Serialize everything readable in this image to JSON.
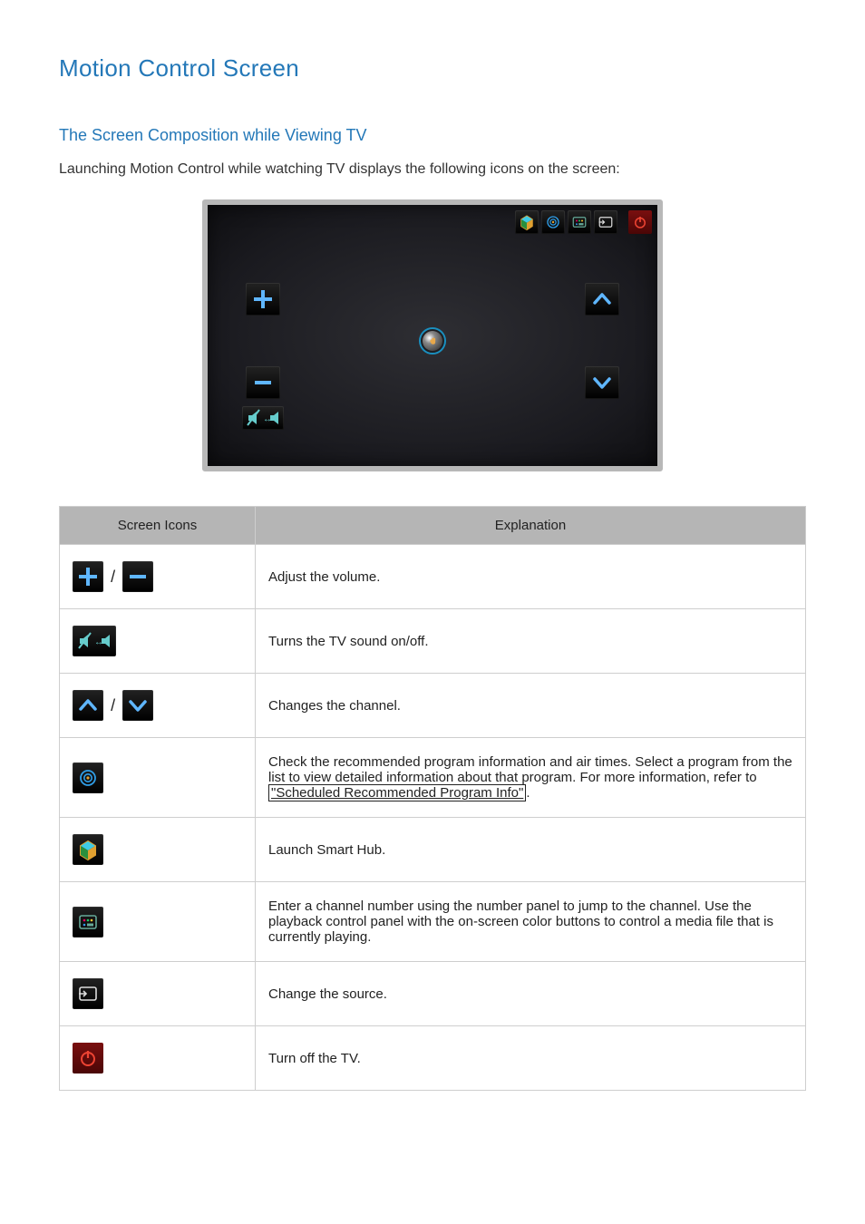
{
  "title": "Motion Control Screen",
  "subtitle": "The Screen Composition while Viewing TV",
  "intro": "Launching Motion Control while watching TV displays the following icons on the screen:",
  "top_icons": [
    {
      "name": "smart-hub-icon"
    },
    {
      "name": "program-info-icon"
    },
    {
      "name": "number-panel-icon"
    },
    {
      "name": "source-icon"
    },
    {
      "name": "power-icon"
    }
  ],
  "table": {
    "header_icons": "Screen Icons",
    "header_explanation": "Explanation",
    "rows": [
      {
        "explanation": "Adjust the volume."
      },
      {
        "explanation": "Turns the TV sound on/off."
      },
      {
        "explanation": "Changes the channel."
      },
      {
        "explanation_pre": "Check the recommended program information and air times. Select a program from the list to view detailed information about that program. For more information, refer to ",
        "link_text": "\"Scheduled Recommended Program Info\"",
        "explanation_post": "."
      },
      {
        "explanation": "Launch Smart Hub."
      },
      {
        "explanation": "Enter a channel number using the number panel to jump to the channel. Use the playback control panel with the on-screen color buttons to control a media file that is currently playing."
      },
      {
        "explanation": "Change the source."
      },
      {
        "explanation": "Turn off the TV."
      }
    ]
  }
}
